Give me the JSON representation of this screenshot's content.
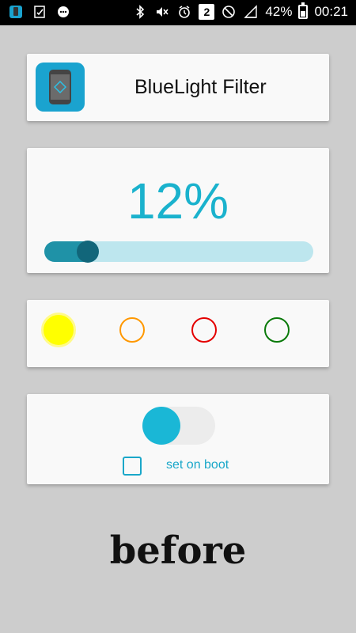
{
  "status_bar": {
    "battery_percent": "42%",
    "time": "00:21",
    "notification_badge": "2",
    "icons": [
      "app-icon",
      "check-icon",
      "chat-icon",
      "bluetooth-icon",
      "mute-icon",
      "alarm-icon",
      "notification-count-icon",
      "do-not-disturb-icon",
      "signal-icon",
      "battery-icon"
    ]
  },
  "app": {
    "title": "BlueLight Filter",
    "icon": "phone-icon"
  },
  "filter": {
    "percent_text": "12%",
    "level": 0.12
  },
  "colors": {
    "options": [
      {
        "name": "yellow",
        "color": "#ffff00",
        "selected": true
      },
      {
        "name": "orange",
        "color": "#ff9800",
        "selected": false
      },
      {
        "name": "red",
        "color": "#e40000",
        "selected": false
      },
      {
        "name": "green",
        "color": "#0a7a0a",
        "selected": false
      }
    ]
  },
  "controls": {
    "toggle_on": true,
    "boot_label": "set on boot",
    "boot_checked": false
  },
  "caption": {
    "text": "before"
  }
}
